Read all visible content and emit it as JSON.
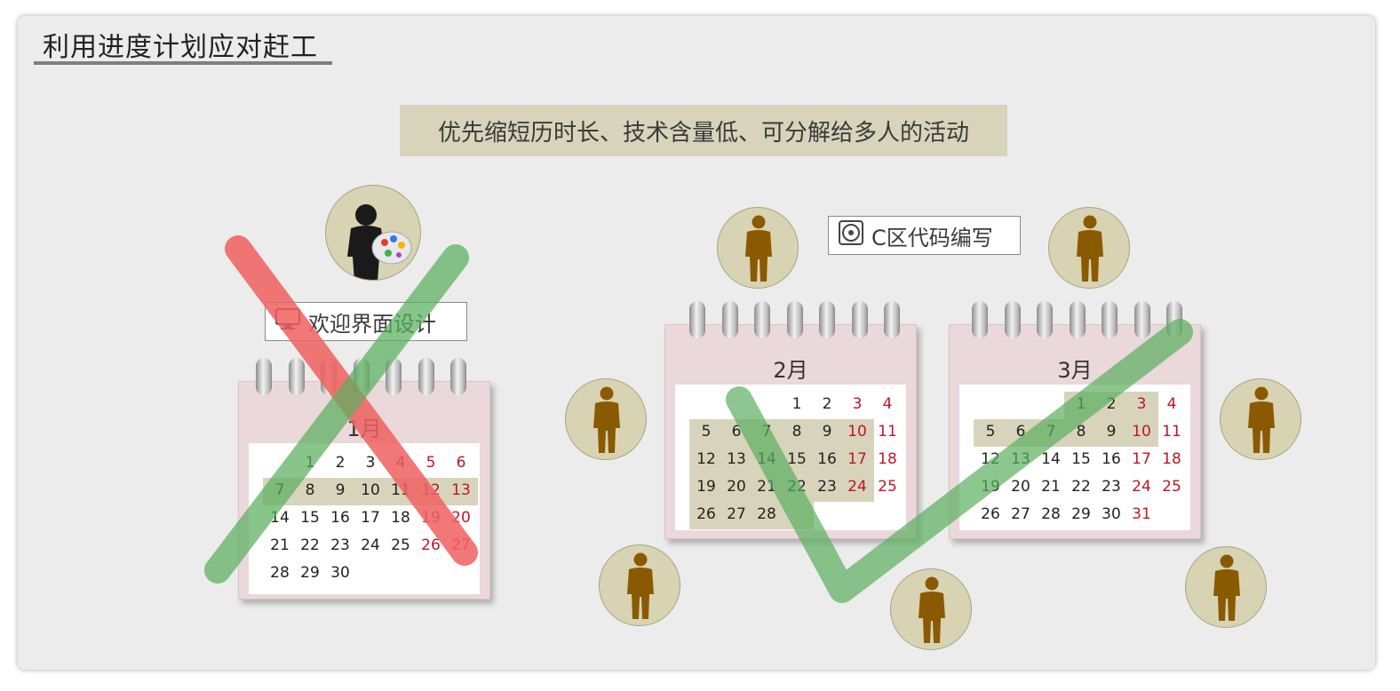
{
  "title": "利用进度计划应对赶工",
  "banner": "优先缩短历时长、技术含量低、可分解给多人的活动",
  "tags": {
    "ui_design": "欢迎界面设计",
    "c_code": "C区代码编写"
  },
  "calendars": [
    {
      "id": "jan",
      "month": "1月",
      "weeks": [
        [
          "",
          "1",
          "2",
          "3",
          "4",
          "5",
          "6"
        ],
        [
          "7",
          "8",
          "9",
          "10",
          "11",
          "12",
          "13"
        ],
        [
          "14",
          "15",
          "16",
          "17",
          "18",
          "19",
          "20"
        ],
        [
          "21",
          "22",
          "23",
          "24",
          "25",
          "26",
          "27"
        ],
        [
          "28",
          "29",
          "30",
          "",
          "",
          "",
          ""
        ]
      ]
    },
    {
      "id": "feb",
      "month": "2月",
      "weeks": [
        [
          "",
          "",
          "",
          "1",
          "2",
          "3",
          "4"
        ],
        [
          "5",
          "6",
          "7",
          "8",
          "9",
          "10",
          "11"
        ],
        [
          "12",
          "13",
          "14",
          "15",
          "16",
          "17",
          "18"
        ],
        [
          "19",
          "20",
          "21",
          "22",
          "23",
          "24",
          "25"
        ],
        [
          "26",
          "27",
          "28",
          "",
          "",
          "",
          ""
        ]
      ]
    },
    {
      "id": "mar",
      "month": "3月",
      "weeks": [
        [
          "",
          "",
          "",
          "1",
          "2",
          "3",
          "4"
        ],
        [
          "5",
          "6",
          "7",
          "8",
          "9",
          "10",
          "11"
        ],
        [
          "12",
          "13",
          "14",
          "15",
          "16",
          "17",
          "18"
        ],
        [
          "19",
          "20",
          "21",
          "22",
          "23",
          "24",
          "25"
        ],
        [
          "26",
          "27",
          "28",
          "29",
          "30",
          "31",
          ""
        ]
      ]
    }
  ],
  "colors": {
    "weekend": "#c0142b",
    "highlight": "#d7d4bb",
    "cross_mark": "#f06060",
    "check_mark": "#5aaf5e",
    "person_figure": "#8a5a00"
  },
  "icons": {
    "designer": "person-with-palette-icon",
    "worker": "person-icon",
    "monitor": "monitor-icon",
    "disc": "disc-icon"
  }
}
